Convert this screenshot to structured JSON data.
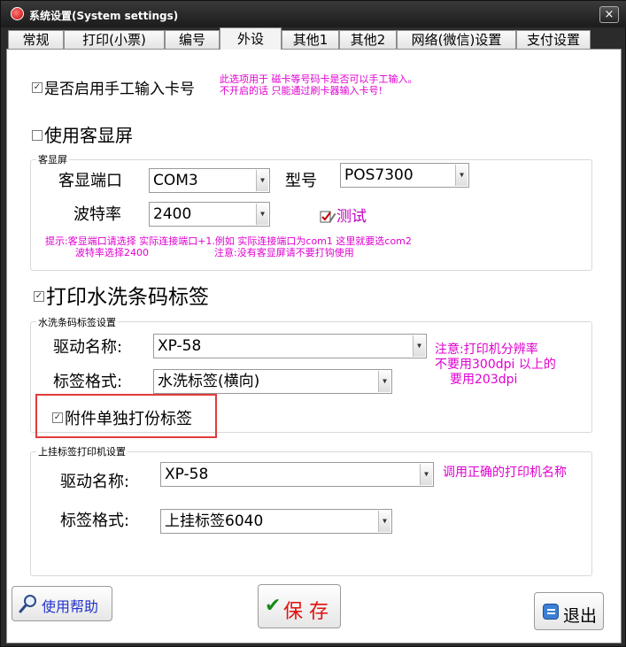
{
  "window": {
    "title": "系统设置(System settings)",
    "close_label": "×"
  },
  "tabs": [
    {
      "label": "常规"
    },
    {
      "label": "打印(小票)"
    },
    {
      "label": "编号"
    },
    {
      "label": "外设"
    },
    {
      "label": "其他1"
    },
    {
      "label": "其他2"
    },
    {
      "label": "网络(微信)设置"
    },
    {
      "label": "支付设置"
    }
  ],
  "active_tab": "外设",
  "manual_card": {
    "checked": true,
    "label": "是否启用手工输入卡号",
    "note_line1": "此选项用于 磁卡等号码卡是否可以手工输入。",
    "note_line2": "不开启的话 只能通过刷卡器输入卡号!"
  },
  "customer_display": {
    "checked": false,
    "label": "使用客显屏",
    "group_title": "客显屏",
    "port_label": "客显端口",
    "port_value": "COM3",
    "model_label": "型号",
    "model_value": "POS7300",
    "baud_label": "波特率",
    "baud_value": "2400",
    "test_label": "测试",
    "hint_line1": "提示:客显端口请选择 实际连接端口+1.例如 实际连接端口为com1 这里就要选com2",
    "hint_line2_a": "波特率选择2400",
    "hint_line2_b": "注意:没有客显屏请不要打钩使用"
  },
  "wash_label": {
    "checked": true,
    "label": "打印水洗条码标签",
    "group_title": "水洗条码标签设置",
    "driver_label": "驱动名称:",
    "driver_value": "XP-58",
    "format_label": "标签格式:",
    "format_value": "水洗标签(横向)",
    "note_line1": "注意:打印机分辨率",
    "note_line2": "不要用300dpi 以上的",
    "note_line3": "要用203dpi",
    "attachment_checked": true,
    "attachment_label": "附件单独打份标签"
  },
  "hang_label": {
    "group_title": "上挂标签打印机设置",
    "driver_label": "驱动名称:",
    "driver_value": "XP-58",
    "driver_note": "调用正确的打印机名称",
    "format_label": "标签格式:",
    "format_value": "上挂标签6040"
  },
  "footer": {
    "help_label": "使用帮助",
    "save_label": "保 存",
    "exit_label": "退出"
  },
  "colors": {
    "note_magenta": "#e000d0",
    "highlight_red": "#e03c3c",
    "titlebar": "#1c1c1c",
    "save_check_green": "#1a8a1a"
  },
  "icons": {
    "app": "app-logo-icon",
    "close": "close-icon",
    "test": "pencil-check-icon",
    "help": "magnifier-icon",
    "save": "checkmark-icon",
    "exit": "exit-icon"
  }
}
